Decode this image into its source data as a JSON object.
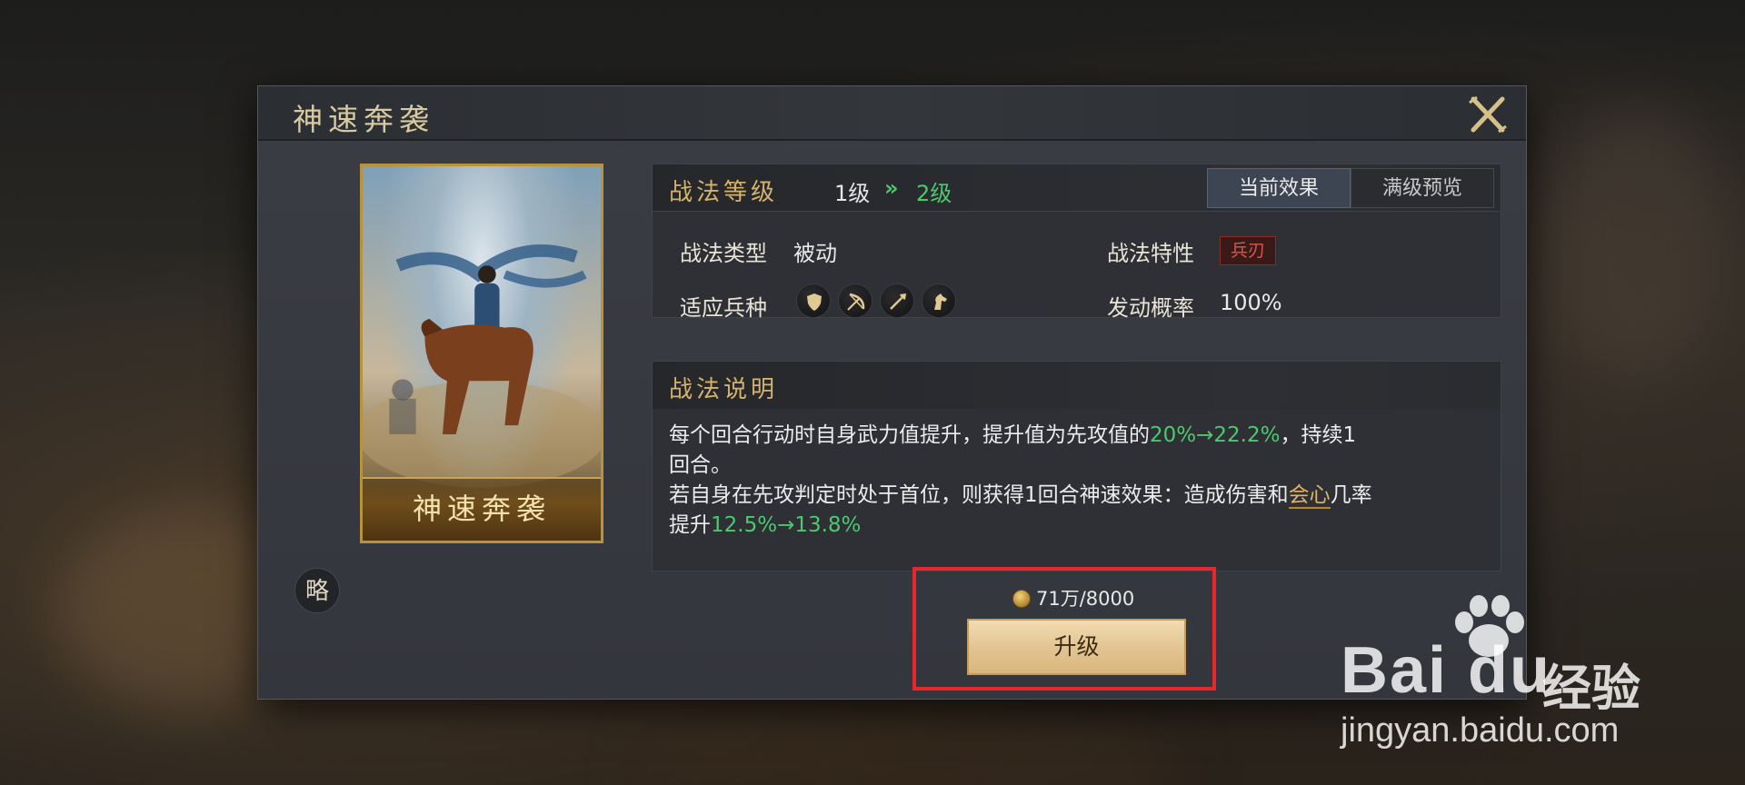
{
  "modal": {
    "title": "神速奔袭",
    "close_icon": "close-x-icon"
  },
  "card": {
    "caption": "神速奔袭"
  },
  "side_badge": "略",
  "info": {
    "level_label": "战法等级",
    "level_from": "1级",
    "level_arrow": "»",
    "level_to": "2级",
    "tabs": [
      {
        "label": "当前效果",
        "active": true
      },
      {
        "label": "满级预览",
        "active": false
      }
    ],
    "type_label": "战法类型",
    "type_value": "被动",
    "trait_label": "战法特性",
    "trait_value": "兵刃",
    "unit_label": "适应兵种",
    "unit_icons": [
      "shield-icon",
      "bow-icon",
      "spear-icon",
      "horse-icon"
    ],
    "rate_label": "发动概率",
    "rate_value": "100%"
  },
  "desc": {
    "title": "战法说明",
    "line1_a": "每个回合行动时自身武力值提升，提升值为先攻值的",
    "line1_green": "20%→22.2%",
    "line1_b": "，持续1",
    "line2": "回合。",
    "line3_a": "若自身在先攻判定时处于首位，则获得1回合神速效果：造成伤害和",
    "line3_link": "会心",
    "line3_b": "几率",
    "line4_a": "提升",
    "line4_green": "12.5%→13.8%"
  },
  "cost": {
    "text": "71万/8000"
  },
  "upgrade_label": "升级",
  "watermark": {
    "logo": "Bai du",
    "cn": "经验",
    "url": "jingyan.baidu.com"
  },
  "colors": {
    "accent_gold": "#d6b26c",
    "green": "#4cc96d",
    "highlight_red": "#e8262b"
  }
}
